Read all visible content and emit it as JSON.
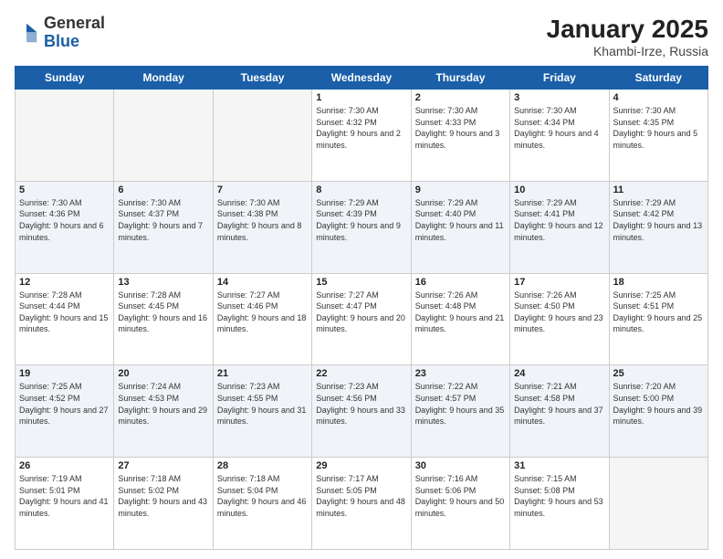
{
  "header": {
    "logo_general": "General",
    "logo_blue": "Blue",
    "month_title": "January 2025",
    "location": "Khambi-Irze, Russia"
  },
  "days_of_week": [
    "Sunday",
    "Monday",
    "Tuesday",
    "Wednesday",
    "Thursday",
    "Friday",
    "Saturday"
  ],
  "weeks": [
    [
      {
        "day": "",
        "info": ""
      },
      {
        "day": "",
        "info": ""
      },
      {
        "day": "",
        "info": ""
      },
      {
        "day": "1",
        "info": "Sunrise: 7:30 AM\nSunset: 4:32 PM\nDaylight: 9 hours and 2 minutes."
      },
      {
        "day": "2",
        "info": "Sunrise: 7:30 AM\nSunset: 4:33 PM\nDaylight: 9 hours and 3 minutes."
      },
      {
        "day": "3",
        "info": "Sunrise: 7:30 AM\nSunset: 4:34 PM\nDaylight: 9 hours and 4 minutes."
      },
      {
        "day": "4",
        "info": "Sunrise: 7:30 AM\nSunset: 4:35 PM\nDaylight: 9 hours and 5 minutes."
      }
    ],
    [
      {
        "day": "5",
        "info": "Sunrise: 7:30 AM\nSunset: 4:36 PM\nDaylight: 9 hours and 6 minutes."
      },
      {
        "day": "6",
        "info": "Sunrise: 7:30 AM\nSunset: 4:37 PM\nDaylight: 9 hours and 7 minutes."
      },
      {
        "day": "7",
        "info": "Sunrise: 7:30 AM\nSunset: 4:38 PM\nDaylight: 9 hours and 8 minutes."
      },
      {
        "day": "8",
        "info": "Sunrise: 7:29 AM\nSunset: 4:39 PM\nDaylight: 9 hours and 9 minutes."
      },
      {
        "day": "9",
        "info": "Sunrise: 7:29 AM\nSunset: 4:40 PM\nDaylight: 9 hours and 11 minutes."
      },
      {
        "day": "10",
        "info": "Sunrise: 7:29 AM\nSunset: 4:41 PM\nDaylight: 9 hours and 12 minutes."
      },
      {
        "day": "11",
        "info": "Sunrise: 7:29 AM\nSunset: 4:42 PM\nDaylight: 9 hours and 13 minutes."
      }
    ],
    [
      {
        "day": "12",
        "info": "Sunrise: 7:28 AM\nSunset: 4:44 PM\nDaylight: 9 hours and 15 minutes."
      },
      {
        "day": "13",
        "info": "Sunrise: 7:28 AM\nSunset: 4:45 PM\nDaylight: 9 hours and 16 minutes."
      },
      {
        "day": "14",
        "info": "Sunrise: 7:27 AM\nSunset: 4:46 PM\nDaylight: 9 hours and 18 minutes."
      },
      {
        "day": "15",
        "info": "Sunrise: 7:27 AM\nSunset: 4:47 PM\nDaylight: 9 hours and 20 minutes."
      },
      {
        "day": "16",
        "info": "Sunrise: 7:26 AM\nSunset: 4:48 PM\nDaylight: 9 hours and 21 minutes."
      },
      {
        "day": "17",
        "info": "Sunrise: 7:26 AM\nSunset: 4:50 PM\nDaylight: 9 hours and 23 minutes."
      },
      {
        "day": "18",
        "info": "Sunrise: 7:25 AM\nSunset: 4:51 PM\nDaylight: 9 hours and 25 minutes."
      }
    ],
    [
      {
        "day": "19",
        "info": "Sunrise: 7:25 AM\nSunset: 4:52 PM\nDaylight: 9 hours and 27 minutes."
      },
      {
        "day": "20",
        "info": "Sunrise: 7:24 AM\nSunset: 4:53 PM\nDaylight: 9 hours and 29 minutes."
      },
      {
        "day": "21",
        "info": "Sunrise: 7:23 AM\nSunset: 4:55 PM\nDaylight: 9 hours and 31 minutes."
      },
      {
        "day": "22",
        "info": "Sunrise: 7:23 AM\nSunset: 4:56 PM\nDaylight: 9 hours and 33 minutes."
      },
      {
        "day": "23",
        "info": "Sunrise: 7:22 AM\nSunset: 4:57 PM\nDaylight: 9 hours and 35 minutes."
      },
      {
        "day": "24",
        "info": "Sunrise: 7:21 AM\nSunset: 4:58 PM\nDaylight: 9 hours and 37 minutes."
      },
      {
        "day": "25",
        "info": "Sunrise: 7:20 AM\nSunset: 5:00 PM\nDaylight: 9 hours and 39 minutes."
      }
    ],
    [
      {
        "day": "26",
        "info": "Sunrise: 7:19 AM\nSunset: 5:01 PM\nDaylight: 9 hours and 41 minutes."
      },
      {
        "day": "27",
        "info": "Sunrise: 7:18 AM\nSunset: 5:02 PM\nDaylight: 9 hours and 43 minutes."
      },
      {
        "day": "28",
        "info": "Sunrise: 7:18 AM\nSunset: 5:04 PM\nDaylight: 9 hours and 46 minutes."
      },
      {
        "day": "29",
        "info": "Sunrise: 7:17 AM\nSunset: 5:05 PM\nDaylight: 9 hours and 48 minutes."
      },
      {
        "day": "30",
        "info": "Sunrise: 7:16 AM\nSunset: 5:06 PM\nDaylight: 9 hours and 50 minutes."
      },
      {
        "day": "31",
        "info": "Sunrise: 7:15 AM\nSunset: 5:08 PM\nDaylight: 9 hours and 53 minutes."
      },
      {
        "day": "",
        "info": ""
      }
    ]
  ]
}
